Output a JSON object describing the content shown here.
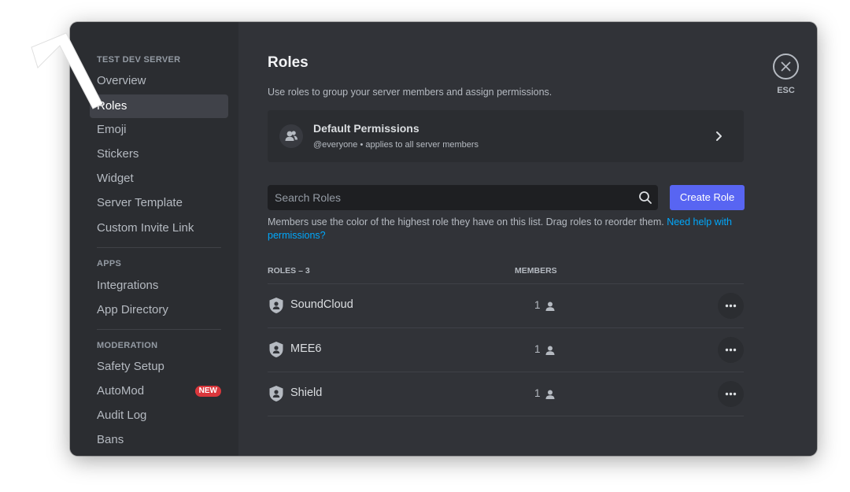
{
  "sidebar": {
    "server_header": "TEST DEV SERVER",
    "server_items": [
      "Overview",
      "Roles",
      "Emoji",
      "Stickers",
      "Widget",
      "Server Template",
      "Custom Invite Link"
    ],
    "active_item": "Roles",
    "apps_header": "APPS",
    "apps_items": [
      "Integrations",
      "App Directory"
    ],
    "moderation_header": "MODERATION",
    "moderation_items": [
      "Safety Setup",
      "AutoMod",
      "Audit Log",
      "Bans"
    ],
    "new_badge": "NEW"
  },
  "main": {
    "title": "Roles",
    "description": "Use roles to group your server members and assign permissions.",
    "default_permissions": {
      "title": "Default Permissions",
      "subtitle": "@everyone • applies to all server members",
      "icon": "members-icon"
    },
    "search": {
      "placeholder": "Search Roles"
    },
    "create_role_label": "Create Role",
    "info_text": "Members use the color of the highest role they have on this list. Drag roles to reorder them. ",
    "help_link": "Need help with permissions?",
    "columns": {
      "roles": "ROLES – 3",
      "members": "MEMBERS"
    },
    "roles": [
      {
        "name": "SoundCloud",
        "members": "1"
      },
      {
        "name": "MEE6",
        "members": "1"
      },
      {
        "name": "Shield",
        "members": "1"
      }
    ]
  },
  "close": {
    "label": "ESC",
    "icon": "close-icon"
  },
  "colors": {
    "sidebar_bg": "#2b2d31",
    "content_bg": "#313338",
    "accent": "#5865f2",
    "link": "#00a8fc",
    "badge": "#da373c"
  }
}
